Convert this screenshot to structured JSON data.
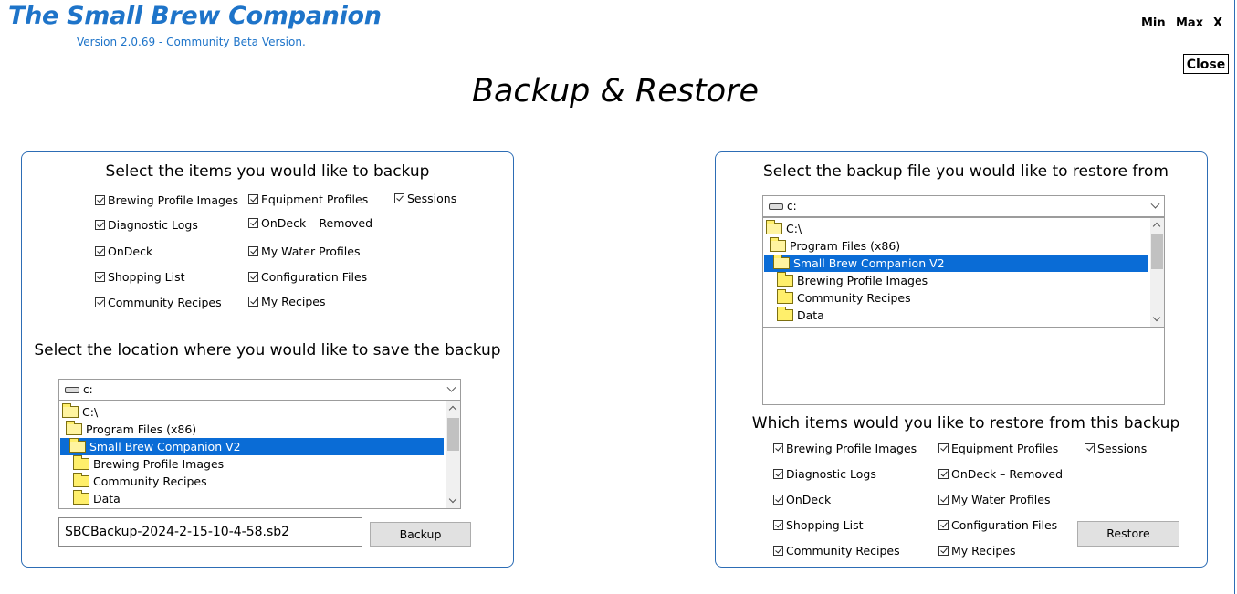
{
  "app": {
    "title": "The Small Brew Companion",
    "version": "Version 2.0.69 - Community Beta Version.",
    "min_label": "Min",
    "max_label": "Max",
    "x_label": "X",
    "close_label": "Close",
    "accent_color": "#1e74c9"
  },
  "page": {
    "title": "Backup & Restore"
  },
  "backup": {
    "items_heading": "Select the items you would like to backup",
    "items": [
      {
        "label": "Brewing Profile Images",
        "checked": true
      },
      {
        "label": "Equipment Profiles",
        "checked": true
      },
      {
        "label": "Sessions",
        "checked": true
      },
      {
        "label": "Diagnostic Logs",
        "checked": true
      },
      {
        "label": "OnDeck – Removed",
        "checked": true
      },
      {
        "label": "OnDeck",
        "checked": true
      },
      {
        "label": "My Water Profiles",
        "checked": true
      },
      {
        "label": "Shopping List",
        "checked": true
      },
      {
        "label": "Configuration Files",
        "checked": true
      },
      {
        "label": "Community Recipes",
        "checked": true
      },
      {
        "label": "My Recipes",
        "checked": true
      }
    ],
    "location_heading": "Select the location where you would like to save the backup",
    "drive": "c:",
    "dirs": [
      {
        "label": "C:\\",
        "icon": "folder-open-icon"
      },
      {
        "label": "Program Files (x86)",
        "icon": "folder-open-icon"
      },
      {
        "label": "Small Brew Companion V2",
        "icon": "folder-open-icon",
        "selected": true
      },
      {
        "label": "Brewing Profile Images",
        "icon": "folder-icon"
      },
      {
        "label": "Community Recipes",
        "icon": "folder-icon"
      },
      {
        "label": "Data",
        "icon": "folder-icon"
      }
    ],
    "filename": "SBCBackup-2024-2-15-10-4-58.sb2",
    "button_label": "Backup"
  },
  "restore": {
    "file_heading": "Select the backup file you would like to restore from",
    "drive": "c:",
    "dirs": [
      {
        "label": "C:\\",
        "icon": "folder-open-icon"
      },
      {
        "label": "Program Files (x86)",
        "icon": "folder-open-icon"
      },
      {
        "label": "Small Brew Companion V2",
        "icon": "folder-open-icon",
        "selected": true
      },
      {
        "label": "Brewing Profile Images",
        "icon": "folder-icon"
      },
      {
        "label": "Community Recipes",
        "icon": "folder-icon"
      },
      {
        "label": "Data",
        "icon": "folder-icon"
      }
    ],
    "items_heading": "Which items would you like to restore from this backup",
    "items": [
      {
        "label": "Brewing Profile Images",
        "checked": true
      },
      {
        "label": "Equipment Profiles",
        "checked": true
      },
      {
        "label": "Sessions",
        "checked": true
      },
      {
        "label": "Diagnostic Logs",
        "checked": true
      },
      {
        "label": "OnDeck – Removed",
        "checked": true
      },
      {
        "label": "OnDeck",
        "checked": true
      },
      {
        "label": "My Water Profiles",
        "checked": true
      },
      {
        "label": "Shopping List",
        "checked": true
      },
      {
        "label": "Configuration Files",
        "checked": true
      },
      {
        "label": "Community Recipes",
        "checked": true
      },
      {
        "label": "My Recipes",
        "checked": true
      }
    ],
    "button_label": "Restore"
  }
}
